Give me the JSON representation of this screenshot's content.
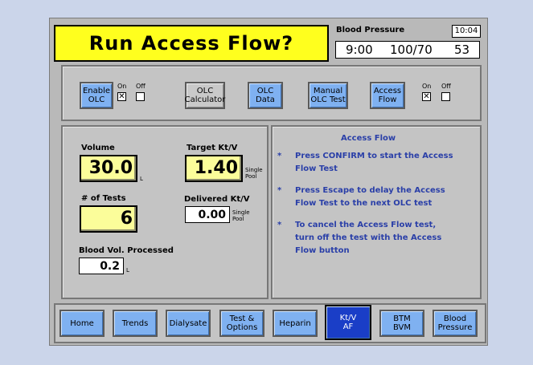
{
  "header": {
    "title": "Run Access Flow?",
    "bp_label": "Blood Pressure",
    "clock": "10:04",
    "bp_time": "9:00",
    "bp_value": "100/70",
    "bp_pulse": "53"
  },
  "toolbar": {
    "enable_olc": "Enable\nOLC",
    "olc_on_label": "On",
    "olc_off_label": "Off",
    "olc_calculator": "OLC\nCalculator",
    "olc_data": "OLC\nData",
    "manual_olc_test": "Manual\nOLC Test",
    "access_flow": "Access\nFlow",
    "af_on_label": "On",
    "af_off_label": "Off",
    "olc_on_checked": true,
    "af_on_checked": true
  },
  "left_panel": {
    "volume_label": "Volume",
    "volume_value": "30.0",
    "volume_unit": "L",
    "tests_label": "# of Tests",
    "tests_value": "6",
    "target_label": "Target Kt/V",
    "target_value": "1.40",
    "target_unit": "Single\nPool",
    "delivered_label": "Delivered Kt/V",
    "delivered_value": "0.00",
    "delivered_unit": "Single\nPool",
    "bvp_label": "Blood Vol. Processed",
    "bvp_value": "0.2",
    "bvp_unit": "L"
  },
  "info_panel": {
    "title": "Access Flow",
    "items": [
      "Press CONFIRM to start the Access\nFlow Test",
      "Press Escape to delay the Access\nFlow Test to the next OLC test",
      "To cancel the Access Flow test,\nturn off the test with the Access\nFlow button"
    ],
    "bullet": "*"
  },
  "nav": {
    "home": "Home",
    "trends": "Trends",
    "dialysate": "Dialysate",
    "tests_options": "Test &\nOptions",
    "heparin": "Heparin",
    "ktv_af": "Kt/V\nAF",
    "btm_bvm": "BTM\nBVM",
    "blood_pressure": "Blood\nPressure"
  },
  "colors": {
    "title_bg": "#ffff1e",
    "button_blue": "#7fb1f1",
    "active_tab": "#1a3ec7",
    "info_text": "#2a3fa8"
  }
}
